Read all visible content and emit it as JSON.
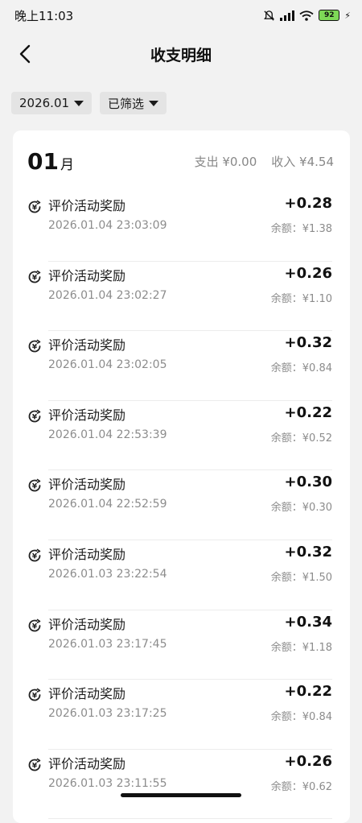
{
  "status_bar": {
    "time": "晚上11:03",
    "battery": "92"
  },
  "header": {
    "title": "收支明细"
  },
  "filters": {
    "date": "2026.01",
    "filter": "已筛选"
  },
  "summary": {
    "month_number": "01",
    "month_unit": "月",
    "expense": "支出 ¥0.00",
    "income": "收入 ¥4.54"
  },
  "transactions": [
    {
      "name": "评价活动奖励",
      "time": "2026.01.04 23:03:09",
      "amount": "+0.28",
      "balance": "余额：¥1.38"
    },
    {
      "name": "评价活动奖励",
      "time": "2026.01.04 23:02:27",
      "amount": "+0.26",
      "balance": "余额：¥1.10"
    },
    {
      "name": "评价活动奖励",
      "time": "2026.01.04 23:02:05",
      "amount": "+0.32",
      "balance": "余额：¥0.84"
    },
    {
      "name": "评价活动奖励",
      "time": "2026.01.04 22:53:39",
      "amount": "+0.22",
      "balance": "余额：¥0.52"
    },
    {
      "name": "评价活动奖励",
      "time": "2026.01.04 22:52:59",
      "amount": "+0.30",
      "balance": "余额：¥0.30"
    },
    {
      "name": "评价活动奖励",
      "time": "2026.01.03 23:22:54",
      "amount": "+0.32",
      "balance": "余额：¥1.50"
    },
    {
      "name": "评价活动奖励",
      "time": "2026.01.03 23:17:45",
      "amount": "+0.34",
      "balance": "余额：¥1.18"
    },
    {
      "name": "评价活动奖励",
      "time": "2026.01.03 23:17:25",
      "amount": "+0.22",
      "balance": "余额：¥0.84"
    },
    {
      "name": "评价活动奖励",
      "time": "2026.01.03 23:11:55",
      "amount": "+0.26",
      "balance": "余额：¥0.62"
    }
  ]
}
